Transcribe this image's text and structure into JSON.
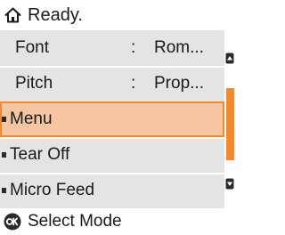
{
  "status": {
    "text": "Ready."
  },
  "menu": {
    "items": [
      {
        "label": "Font",
        "separator": ":",
        "value": "Rom..."
      },
      {
        "label": "Pitch",
        "separator": ":",
        "value": "Prop..."
      },
      {
        "label": "Menu",
        "selected": true
      },
      {
        "label": "Tear Off"
      },
      {
        "label": "Micro Feed"
      }
    ]
  },
  "footer": {
    "text": "Select Mode",
    "icon": "ok-button-icon"
  },
  "colors": {
    "selected_fill": "#f7c6a0",
    "accent": "#f08a30",
    "panel": "#e4e4e4"
  }
}
